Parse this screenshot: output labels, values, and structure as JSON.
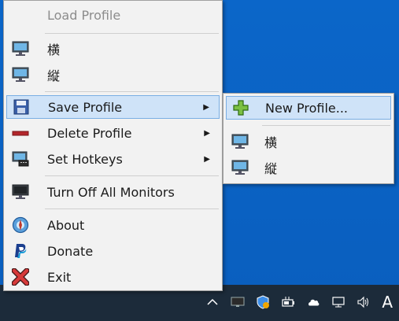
{
  "colors": {
    "desktop": "#0a63c4",
    "taskbar": "#1c2b3a",
    "menu_bg": "#f2f2f2",
    "highlight_bg": "#cfe3f8",
    "highlight_border": "#7aaee4"
  },
  "main_menu": {
    "items": [
      {
        "label": "Load Profile",
        "icon": "none",
        "disabled": true
      },
      {
        "label": "横",
        "icon": "monitor-icon"
      },
      {
        "label": "縦",
        "icon": "monitor-icon"
      },
      {
        "label": "Save Profile",
        "icon": "floppy-disk-icon",
        "has_submenu": true,
        "highlighted": true
      },
      {
        "label": "Delete Profile",
        "icon": "minus-icon",
        "has_submenu": true
      },
      {
        "label": "Set Hotkeys",
        "icon": "monitor-keyboard-icon",
        "has_submenu": true
      },
      {
        "label": "Turn Off All Monitors",
        "icon": "monitor-off-icon"
      },
      {
        "label": "About",
        "icon": "globe-icon"
      },
      {
        "label": "Donate",
        "icon": "paypal-icon"
      },
      {
        "label": "Exit",
        "icon": "red-x-icon"
      }
    ],
    "submenu_arrow": "▶"
  },
  "submenu": {
    "items": [
      {
        "label": "New Profile...",
        "icon": "green-plus-icon",
        "highlighted": true
      },
      {
        "label": "横",
        "icon": "monitor-icon"
      },
      {
        "label": "縦",
        "icon": "monitor-icon"
      }
    ]
  },
  "taskbar": {
    "tray_icons": [
      "chevron-up-icon",
      "monitor-tray-icon",
      "shield-icon",
      "battery-plug-icon",
      "onedrive-cloud-icon",
      "network-icon",
      "volume-icon"
    ],
    "ime_indicator": "A"
  }
}
